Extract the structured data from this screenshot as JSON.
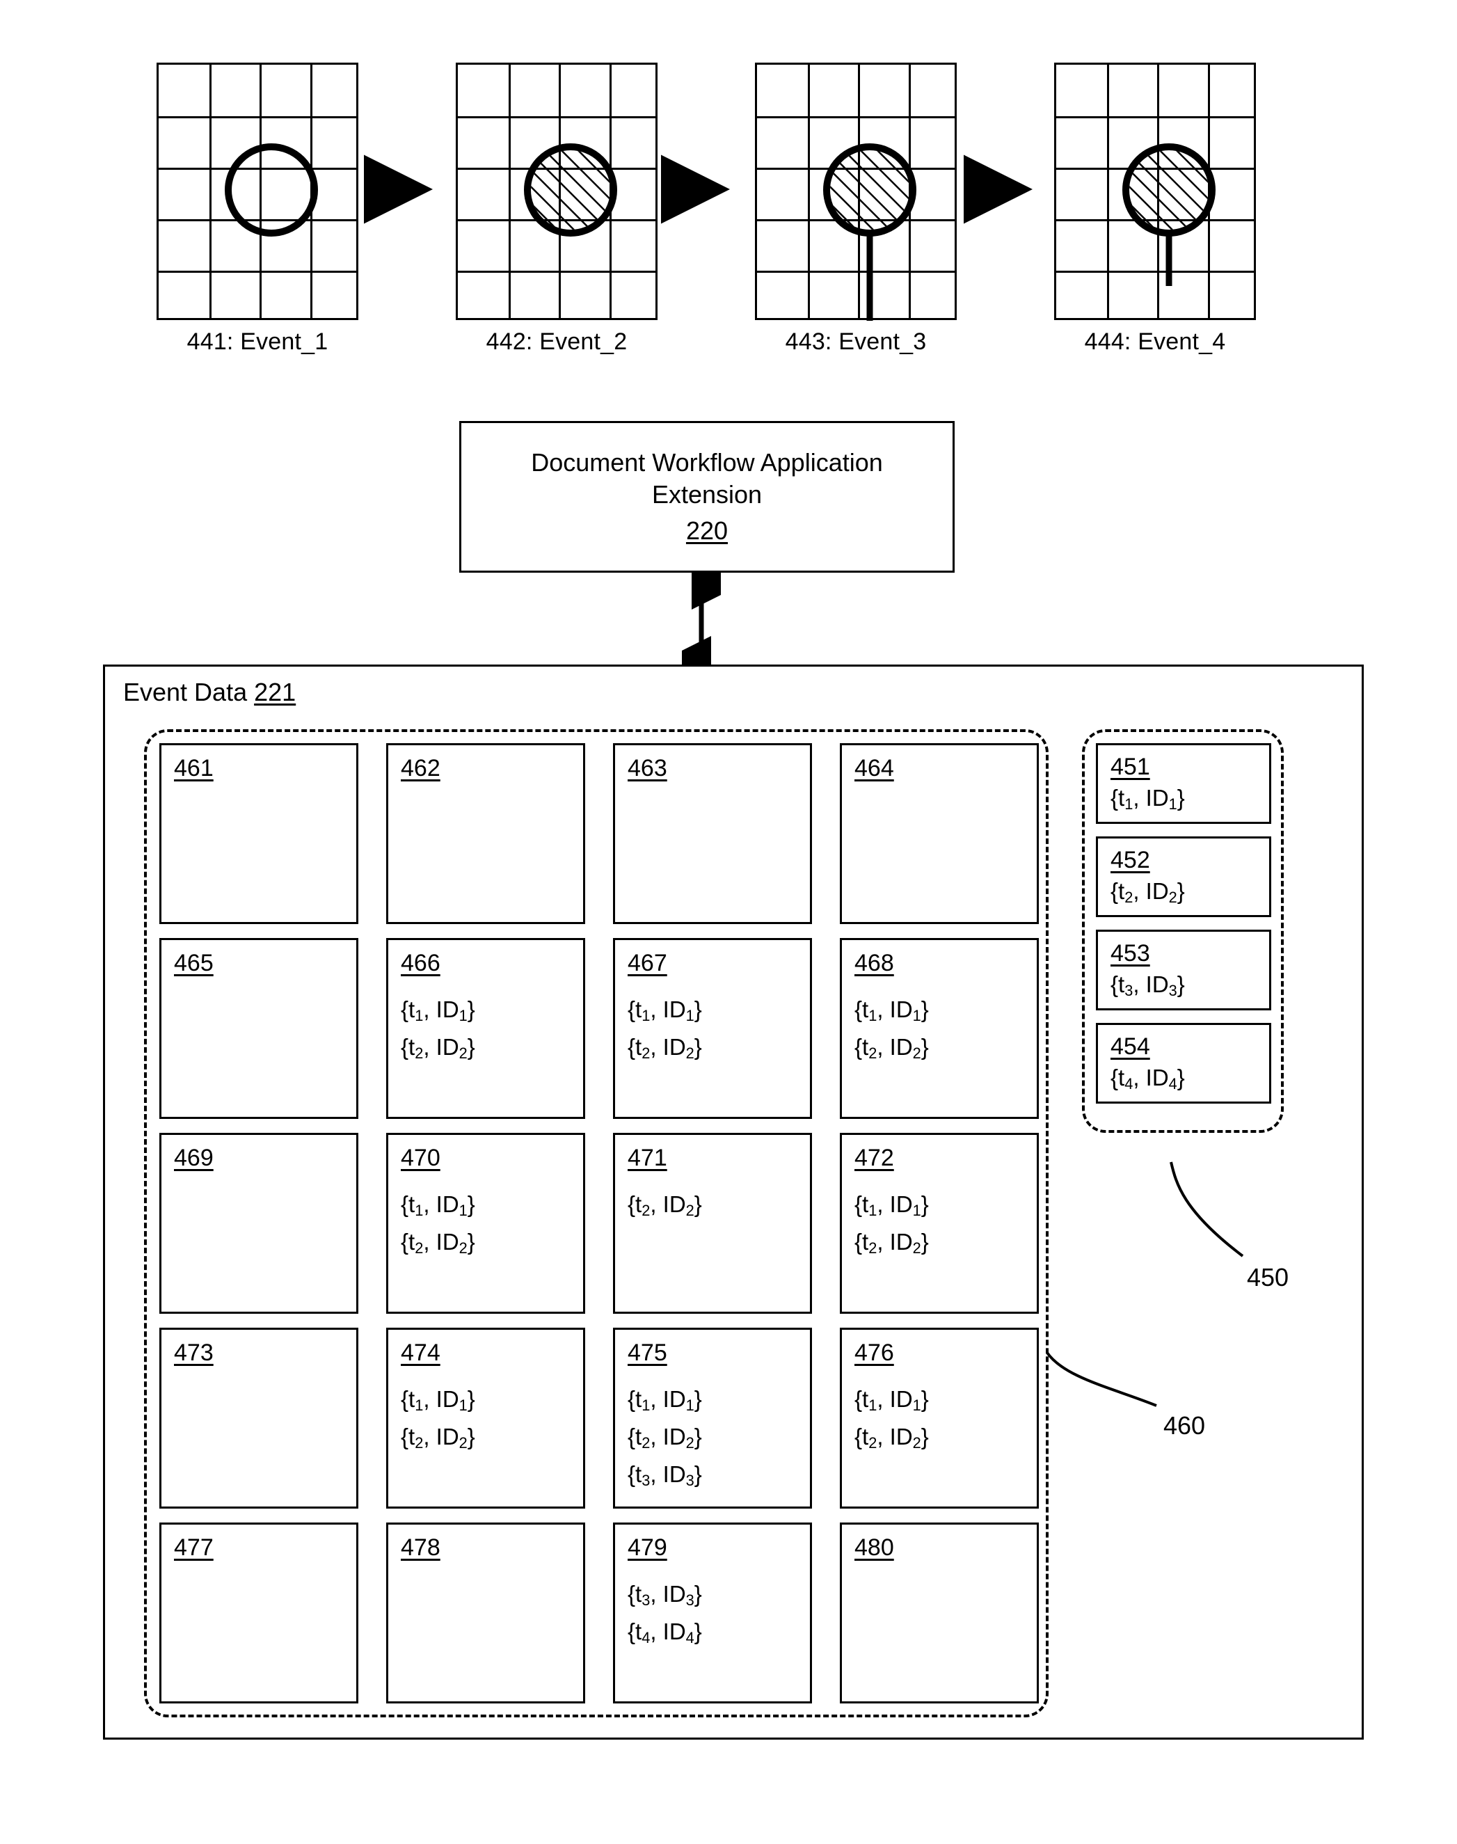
{
  "events": {
    "panels": [
      {
        "label": "441: Event_1",
        "state": "hollow-circle",
        "stem": "none"
      },
      {
        "label": "442: Event_2",
        "state": "hatched-circle",
        "stem": "none"
      },
      {
        "label": "443: Event_3",
        "state": "hatched-circle",
        "stem": "long"
      },
      {
        "label": "444: Event_4",
        "state": "hatched-circle",
        "stem": "short"
      }
    ],
    "arrow_icon": "right-arrow-icon",
    "grid_columns": 4,
    "grid_rows": 5
  },
  "workflow": {
    "title": "Document Workflow Application Extension",
    "reference": "220",
    "connector_icon": "double-headed-vertical-arrow-icon"
  },
  "event_data": {
    "heading_text": "Event Data",
    "heading_reference": "221",
    "callouts": [
      {
        "label": "450",
        "target": "event-queue-group"
      },
      {
        "label": "460",
        "target": "document-cell-grid"
      }
    ],
    "queue": [
      {
        "ref": "451",
        "entry": "{t1, ID1}",
        "t": "1",
        "id": "1"
      },
      {
        "ref": "452",
        "entry": "{t2, ID2}",
        "t": "2",
        "id": "2"
      },
      {
        "ref": "453",
        "entry": "{t3, ID3}",
        "t": "3",
        "id": "3"
      },
      {
        "ref": "454",
        "entry": "{t4, ID4}",
        "t": "4",
        "id": "4"
      }
    ],
    "cells": [
      {
        "ref": "461",
        "entries": []
      },
      {
        "ref": "462",
        "entries": []
      },
      {
        "ref": "463",
        "entries": []
      },
      {
        "ref": "464",
        "entries": []
      },
      {
        "ref": "465",
        "entries": []
      },
      {
        "ref": "466",
        "entries": [
          "1",
          "2"
        ]
      },
      {
        "ref": "467",
        "entries": [
          "1",
          "2"
        ]
      },
      {
        "ref": "468",
        "entries": [
          "1",
          "2"
        ]
      },
      {
        "ref": "469",
        "entries": []
      },
      {
        "ref": "470",
        "entries": [
          "1",
          "2"
        ]
      },
      {
        "ref": "471",
        "entries": [
          "2"
        ]
      },
      {
        "ref": "472",
        "entries": [
          "1",
          "2"
        ]
      },
      {
        "ref": "473",
        "entries": []
      },
      {
        "ref": "474",
        "entries": [
          "1",
          "2"
        ]
      },
      {
        "ref": "475",
        "entries": [
          "1",
          "2",
          "3"
        ]
      },
      {
        "ref": "476",
        "entries": [
          "1",
          "2"
        ]
      },
      {
        "ref": "477",
        "entries": []
      },
      {
        "ref": "478",
        "entries": []
      },
      {
        "ref": "479",
        "entries": [
          "3",
          "4"
        ]
      },
      {
        "ref": "480",
        "entries": []
      }
    ]
  },
  "colors": {
    "ink": "#000000",
    "paper": "#ffffff"
  }
}
